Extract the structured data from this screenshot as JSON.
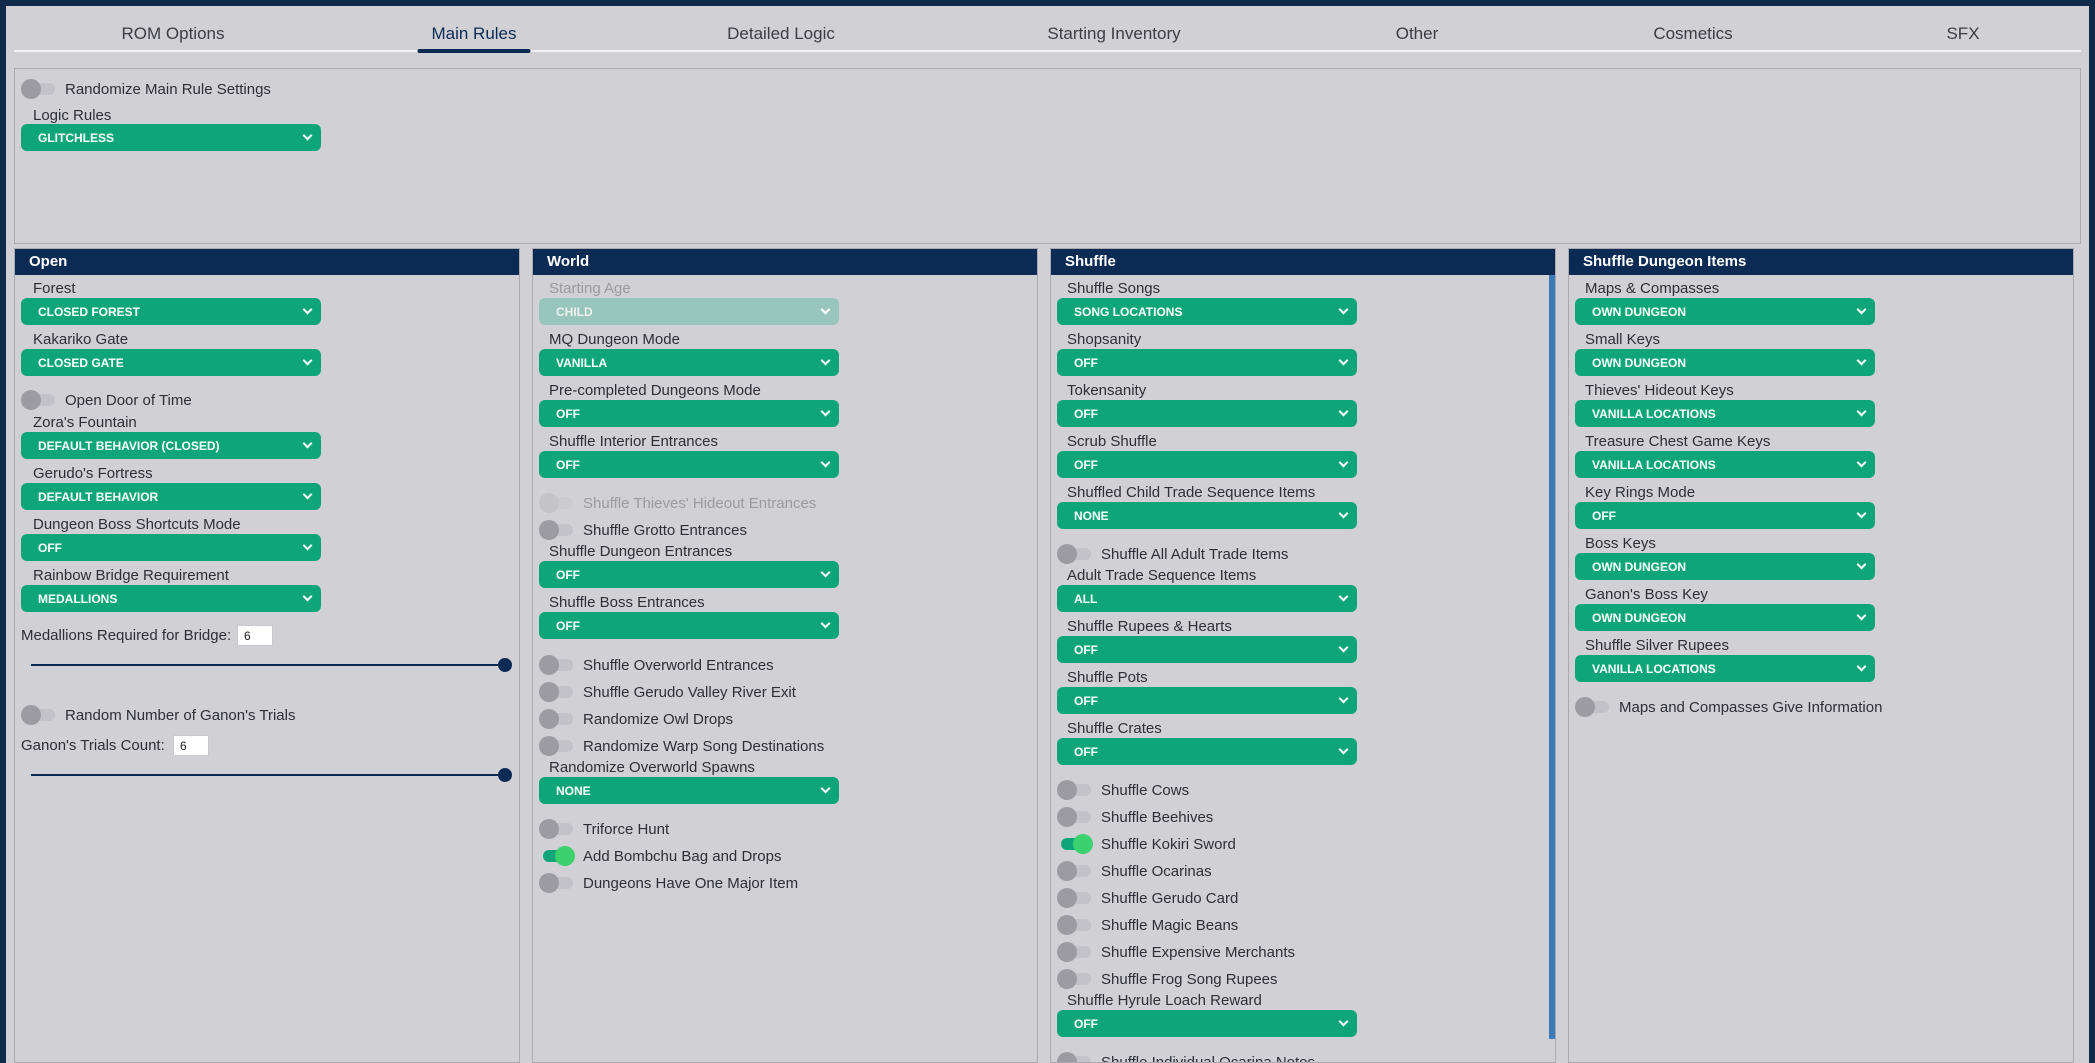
{
  "tabs": [
    {
      "label": "ROM Options"
    },
    {
      "label": "Main Rules"
    },
    {
      "label": "Detailed Logic"
    },
    {
      "label": "Starting Inventory"
    },
    {
      "label": "Other"
    },
    {
      "label": "Cosmetics"
    },
    {
      "label": "SFX"
    }
  ],
  "active_tab": "Main Rules",
  "top": {
    "randomize_label": "Randomize Main Rule Settings",
    "logic_label": "Logic Rules",
    "logic_value": "GLITCHLESS"
  },
  "colors": {
    "header": "#0c2b54",
    "select": "#0ea678",
    "toggle_on": "#3bd16e"
  },
  "open": {
    "title": "Open",
    "forest_label": "Forest",
    "forest_value": "CLOSED FOREST",
    "kakariko_label": "Kakariko Gate",
    "kakariko_value": "CLOSED GATE",
    "door_label": "Open Door of Time",
    "zora_label": "Zora's Fountain",
    "zora_value": "DEFAULT BEHAVIOR (CLOSED)",
    "gerudo_label": "Gerudo's Fortress",
    "gerudo_value": "DEFAULT BEHAVIOR",
    "boss_shortcuts_label": "Dungeon Boss Shortcuts Mode",
    "boss_shortcuts_value": "OFF",
    "rainbow_label": "Rainbow Bridge Requirement",
    "rainbow_value": "MEDALLIONS",
    "medallions_label": "Medallions Required for Bridge:",
    "medallions_value": "6",
    "medallions_fraction": 1.0,
    "random_trials_label": "Random Number of Ganon's Trials",
    "trials_label": "Ganon's Trials Count:",
    "trials_value": "6",
    "trials_fraction": 1.0
  },
  "world": {
    "title": "World",
    "starting_age_label": "Starting Age",
    "starting_age_value": "CHILD",
    "mq_label": "MQ Dungeon Mode",
    "mq_value": "VANILLA",
    "precompleted_label": "Pre-completed Dungeons Mode",
    "precompleted_value": "OFF",
    "interior_label": "Shuffle Interior Entrances",
    "interior_value": "OFF",
    "thieves_hideout_label": "Shuffle Thieves' Hideout Entrances",
    "grotto_label": "Shuffle Grotto Entrances",
    "dungeon_ent_label": "Shuffle Dungeon Entrances",
    "dungeon_ent_value": "OFF",
    "boss_ent_label": "Shuffle Boss Entrances",
    "boss_ent_value": "OFF",
    "overworld_label": "Shuffle Overworld Entrances",
    "gerudo_river_label": "Shuffle Gerudo Valley River Exit",
    "owl_label": "Randomize Owl Drops",
    "warp_label": "Randomize Warp Song Destinations",
    "spawns_label": "Randomize Overworld Spawns",
    "spawns_value": "NONE",
    "triforce_label": "Triforce Hunt",
    "bombchu_label": "Add Bombchu Bag and Drops",
    "major_item_label": "Dungeons Have One Major Item"
  },
  "shuffle": {
    "title": "Shuffle",
    "songs_label": "Shuffle Songs",
    "songs_value": "SONG LOCATIONS",
    "shopsanity_label": "Shopsanity",
    "shopsanity_value": "OFF",
    "tokensanity_label": "Tokensanity",
    "tokensanity_value": "OFF",
    "scrub_label": "Scrub Shuffle",
    "scrub_value": "OFF",
    "child_trade_label": "Shuffled Child Trade Sequence Items",
    "child_trade_value": "NONE",
    "all_adult_label": "Shuffle All Adult Trade Items",
    "adult_trade_label": "Adult Trade Sequence Items",
    "adult_trade_value": "ALL",
    "rupees_label": "Shuffle Rupees & Hearts",
    "rupees_value": "OFF",
    "pots_label": "Shuffle Pots",
    "pots_value": "OFF",
    "crates_label": "Shuffle Crates",
    "crates_value": "OFF",
    "cows_label": "Shuffle Cows",
    "beehives_label": "Shuffle Beehives",
    "kokiri_label": "Shuffle Kokiri Sword",
    "ocarinas_label": "Shuffle Ocarinas",
    "gerudo_card_label": "Shuffle Gerudo Card",
    "beans_label": "Shuffle Magic Beans",
    "merchants_label": "Shuffle Expensive Merchants",
    "frog_label": "Shuffle Frog Song Rupees",
    "loach_label": "Shuffle Hyrule Loach Reward",
    "loach_value": "OFF",
    "ocarina_notes_label": "Shuffle Individual Ocarina Notes"
  },
  "dungeon_items": {
    "title": "Shuffle Dungeon Items",
    "maps_label": "Maps & Compasses",
    "maps_value": "OWN DUNGEON",
    "small_keys_label": "Small Keys",
    "small_keys_value": "OWN DUNGEON",
    "thieves_keys_label": "Thieves' Hideout Keys",
    "thieves_keys_value": "VANILLA LOCATIONS",
    "chest_game_label": "Treasure Chest Game Keys",
    "chest_game_value": "VANILLA LOCATIONS",
    "key_rings_label": "Key Rings Mode",
    "key_rings_value": "OFF",
    "boss_keys_label": "Boss Keys",
    "boss_keys_value": "OWN DUNGEON",
    "ganon_key_label": "Ganon's Boss Key",
    "ganon_key_value": "OWN DUNGEON",
    "silver_rupees_label": "Shuffle Silver Rupees",
    "silver_rupees_value": "VANILLA LOCATIONS",
    "maps_info_label": "Maps and Compasses Give Information"
  }
}
